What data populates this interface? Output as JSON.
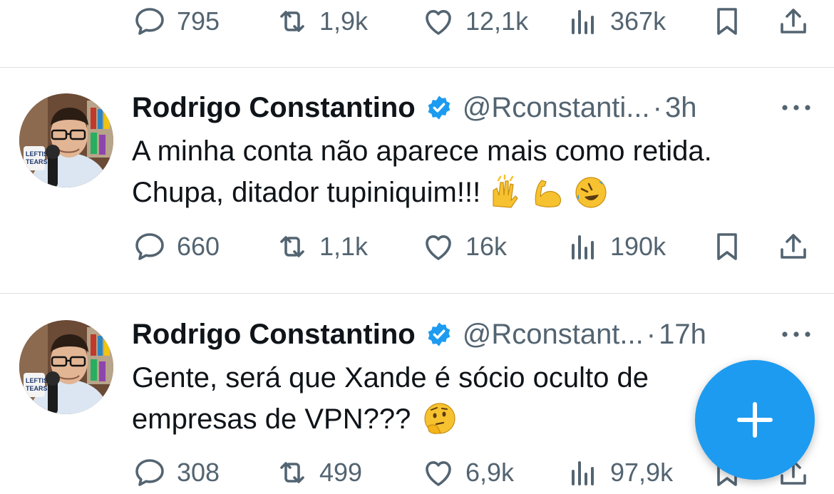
{
  "top_actions": {
    "replies": "795",
    "retweets": "1,9k",
    "likes": "12,1k",
    "views": "367k"
  },
  "tweets": [
    {
      "name": "Rodrigo Constantino",
      "handle": "@Rconstanti...",
      "dot": "·",
      "time": "3h",
      "line1": "A minha conta não aparece mais como retida.",
      "line2": "Chupa, ditador tupiniquim!!!",
      "replies": "660",
      "retweets": "1,1k",
      "likes": "16k",
      "views": "190k"
    },
    {
      "name": "Rodrigo Constantino",
      "handle": "@Rconstant...",
      "dot": "·",
      "time": "17h",
      "line1": "Gente, será que Xande é sócio oculto de",
      "line2": "empresas de VPN???",
      "replies": "308",
      "retweets": "499",
      "likes": "6,9k",
      "views": "97,9k"
    }
  ],
  "colors": {
    "accent": "#1d9bf0",
    "text": "#0f1419",
    "muted": "#536471",
    "divider": "#dcdfe2"
  },
  "icons": [
    "reply-icon",
    "retweet-icon",
    "like-icon",
    "views-icon",
    "bookmark-icon",
    "share-icon",
    "verified-badge-icon",
    "more-icon",
    "compose-plus-icon",
    "raising-hands-emoji",
    "flexed-biceps-emoji",
    "rofl-emoji",
    "thinking-emoji"
  ]
}
